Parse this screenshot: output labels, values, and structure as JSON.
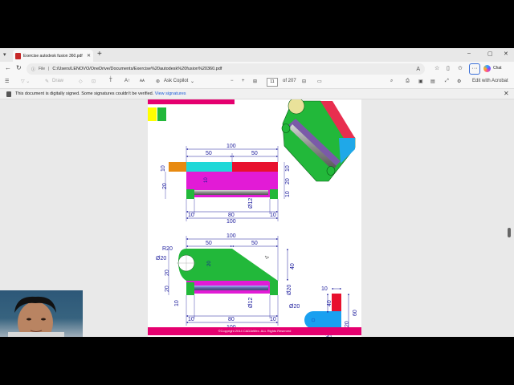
{
  "browser": {
    "tab_title": "Exercise autodesk fusion 360.pdf",
    "tab_close": "✕",
    "new_tab": "+",
    "url_prefix": "File",
    "url": "C:/Users/LENOVO/OneDrive/Documents/Exercise%20autodesk%20fusion%20360.pdf",
    "more": "···",
    "chat_label": "Chat",
    "window_controls": [
      "–",
      "▢",
      "✕"
    ]
  },
  "pdf_toolbar": {
    "draw_label": "Draw",
    "ask_copilot_label": "Ask Copilot",
    "zoom_out": "−",
    "zoom_in": "+",
    "page_current": "11",
    "page_total": "of 207",
    "edit_acrobat_label": "Edit with Acrobat"
  },
  "signature_bar": {
    "message": "This document is digitally signed. Some signatures couldn't be verified.",
    "link": "View signatures",
    "close": "✕"
  },
  "drawing": {
    "copyright": "©Copyright 2014 CADArtifex. ALL Rights Reserved",
    "top_view": {
      "overall_width": "100",
      "left_half": "50",
      "right_half": "50",
      "left_small": "10",
      "height_20": "20",
      "right_10_top": "10",
      "right_20": "20",
      "right_10_bottom": "10",
      "inner_10": "10",
      "bottom_left_10": "10",
      "bottom_center_80": "80",
      "bottom_right_10": "10",
      "bottom_overall": "100",
      "dia_12": "Ø12"
    },
    "front_view": {
      "overall_width": "100",
      "left_half": "50",
      "right_half": "50",
      "radius": "R20",
      "hole_dia": "Ø20",
      "inner_20": "20",
      "left_20_top": "20",
      "left_20_bottom": "20",
      "left_10": "10",
      "right_40": "40",
      "right_dia_20": "Ø20",
      "dia_12": "Ø12",
      "bottom_left_10": "10",
      "bottom_center_80": "80",
      "bottom_right_10": "10",
      "bottom_overall": "100"
    },
    "side_view": {
      "top_10": "10",
      "height_40": "40",
      "height_60": "60",
      "bottom_20": "20",
      "dia_20": "Ø20",
      "width_30": "30"
    }
  },
  "colors": {
    "green": "#22b83a",
    "magenta": "#e21bd6",
    "cyan": "#1fd8d8",
    "red": "#e8102e",
    "blue": "#1aa0f0",
    "dim_line": "#1b1b9c",
    "pink_bar": "#e5006f"
  }
}
